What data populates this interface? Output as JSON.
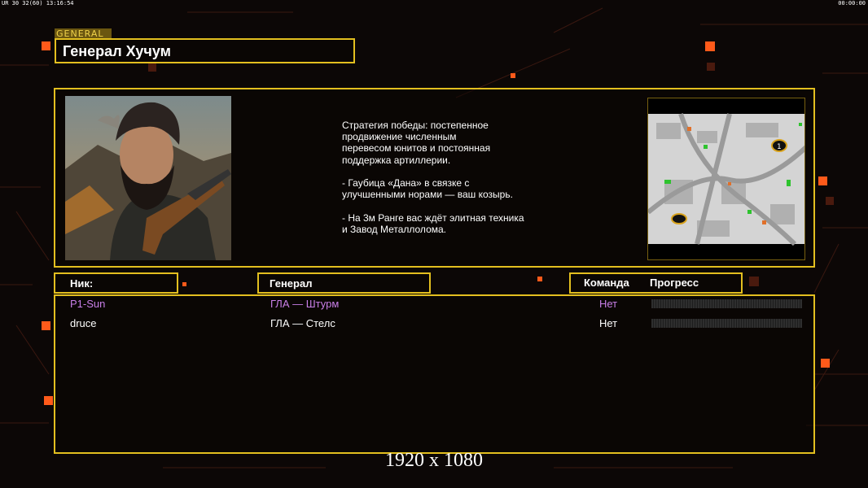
{
  "overlay": {
    "fps": "UR 30 32(60) 13:16:54",
    "timer": "00:00:00"
  },
  "general": {
    "tag": "GENERAL",
    "name": "Генерал Хучум",
    "description": "Стратегия победы: постепенное\nпродвижение численным\nперевесом юнитов и постоянная\nподдержка артиллерии.\n\n- Гаубица «Дана» в связке с\nулучшенными норами — ваш козырь.\n\n- На 3м Ранге вас ждёт элитная техника\nи Завод Металлолома."
  },
  "minimap": {
    "start_marker": "1"
  },
  "table": {
    "headers": {
      "nick": "Ник:",
      "general": "Генерал",
      "team": "Команда",
      "progress": "Прогресс"
    },
    "rows": [
      {
        "nick": "P1-Sun",
        "general": "ГЛА — Штурм",
        "team": "Нет",
        "color": "#c97fe8",
        "progress": 0
      },
      {
        "nick": "druce",
        "general": "ГЛА — Стелс",
        "team": "Нет",
        "color": "#ffffff",
        "progress": 0
      }
    ]
  },
  "resolution": "1920 x 1080",
  "colors": {
    "accent": "#e3bf1f",
    "highlight_square": "#ff5a1a",
    "background": "#0c0706"
  }
}
